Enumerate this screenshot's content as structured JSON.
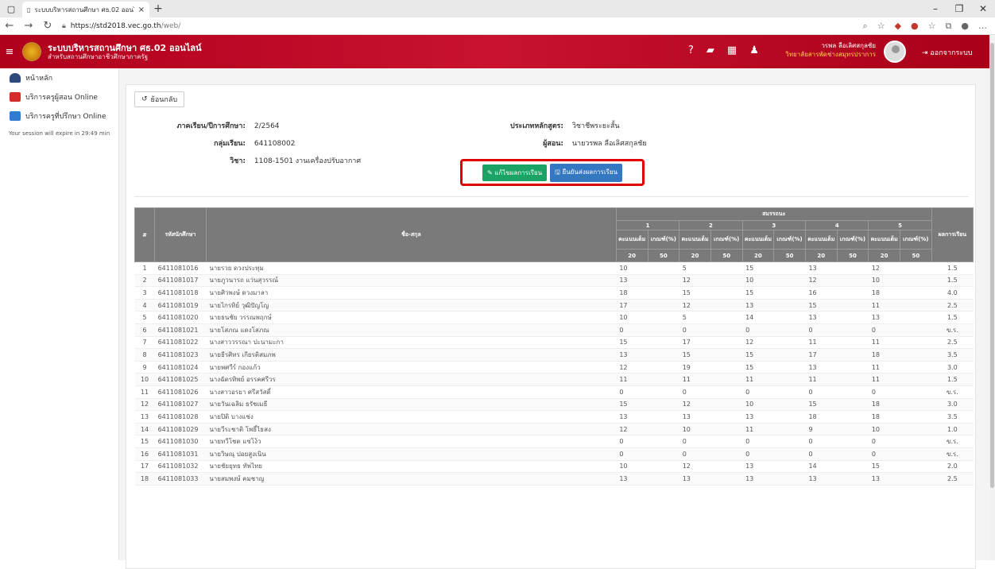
{
  "browser": {
    "tab_title": "ระบบบริหารสถานศึกษา ศธ.02 ออนไล",
    "url_host": "https://std2018.vec.go.th",
    "url_path": "/web/"
  },
  "header": {
    "title": "ระบบบริหารสถานศึกษา ศธ.02 ออนไลน์",
    "subtitle": "สำหรับสถานศึกษาอาชีวศึกษาภาครัฐ",
    "user_name": "วรพล ลือเลิศสกุลชัย",
    "user_org": "วิทยาลัยสารพัดช่างสมุทรปราการ",
    "logout": "ออกจากระบบ"
  },
  "sidebar": {
    "items": [
      {
        "label": "หน้าหลัก"
      },
      {
        "label": "บริการครูผู้สอน Online"
      },
      {
        "label": "บริการครูที่ปรึกษา Online"
      }
    ],
    "session": "Your session will expire in 29:49 min"
  },
  "page": {
    "back_label": "ย้อนกลับ",
    "term_label": "ภาคเรียน/ปีการศึกษา:",
    "term_value": "2/2564",
    "group_label": "กลุ่มเรียน:",
    "group_value": "641108002",
    "subject_label": "วิชา:",
    "subject_value": "1108-1501  งานเครื่องปรับอากาศ",
    "course_type_label": "ประเภทหลักสูตร:",
    "course_type_value": "วิชาชีพระยะสั้น",
    "teacher_label": "ผู้สอน:",
    "teacher_value": "นายวรพล ลือเลิศสกุลชัย",
    "edit_button": "แก้ไขผลการเรียน",
    "confirm_button": "ยืนยันส่งผลการเรียน"
  },
  "table": {
    "h_no": "#",
    "h_id": "รหัสนักศึกษา",
    "h_name": "ชื่อ-สกุล",
    "h_comp": "สมรรถนะ",
    "h_result": "ผลการเรียน",
    "comp_nums": [
      "1",
      "2",
      "3",
      "4",
      "5"
    ],
    "h_score": "คะแนนเต็ม",
    "h_crit": "เกณฑ์(%)",
    "h_score_val": "20",
    "h_crit_val": "50",
    "rows": [
      [
        "1",
        "6411081016",
        "นายรวย ดวงประทุม",
        "10",
        "5",
        "15",
        "13",
        "12",
        "1.5"
      ],
      [
        "2",
        "6411081017",
        "นายภูวนารถ แว่นสุวรรณ์",
        "13",
        "12",
        "10",
        "12",
        "10",
        "1.5"
      ],
      [
        "3",
        "6411081018",
        "นายศิวพงษ์ ดวงมาลา",
        "18",
        "15",
        "15",
        "16",
        "18",
        "4.0"
      ],
      [
        "4",
        "6411081019",
        "นายไกรทิย์ วุฒิปัญโญ",
        "17",
        "12",
        "13",
        "15",
        "11",
        "2.5"
      ],
      [
        "5",
        "6411081020",
        "นายธนชัย วรรณพฤกษ์",
        "10",
        "5",
        "14",
        "13",
        "13",
        "1.5"
      ],
      [
        "6",
        "6411081021",
        "นายโสภณ แดงโสภณ",
        "0",
        "0",
        "0",
        "0",
        "0",
        "ข.ร."
      ],
      [
        "7",
        "6411081022",
        "นางสาววรรณา ปะนามะกา",
        "15",
        "17",
        "12",
        "11",
        "11",
        "2.5"
      ],
      [
        "8",
        "6411081023",
        "นายธีรศิทร เกียรติสมภพ",
        "13",
        "15",
        "15",
        "17",
        "18",
        "3.5"
      ],
      [
        "9",
        "6411081024",
        "นายพศวีร์ กองแก้ว",
        "12",
        "19",
        "15",
        "13",
        "11",
        "3.0"
      ],
      [
        "10",
        "6411081025",
        "นางฉัตรทิพย์ อรรคศรีวร",
        "11",
        "11",
        "11",
        "11",
        "11",
        "1.5"
      ],
      [
        "11",
        "6411081026",
        "นางสาวอรยา ศรีสวัสดิ์",
        "0",
        "0",
        "0",
        "0",
        "0",
        "ข.ร."
      ],
      [
        "12",
        "6411081027",
        "นายวันเฉลิม ธรัชเมธี",
        "15",
        "12",
        "10",
        "15",
        "18",
        "3.0"
      ],
      [
        "13",
        "6411081028",
        "นายปิติ บางแช่ง",
        "13",
        "13",
        "13",
        "18",
        "18",
        "3.5"
      ],
      [
        "14",
        "6411081029",
        "นายวีระชาติ โพธิ์ไธสง",
        "12",
        "10",
        "11",
        "9",
        "10",
        "1.0"
      ],
      [
        "15",
        "6411081030",
        "นายทวีโชต แซ่โง้ว",
        "0",
        "0",
        "0",
        "0",
        "0",
        "ข.ร."
      ],
      [
        "16",
        "6411081031",
        "นายวิษณุ ปอยสูงเนิน",
        "0",
        "0",
        "0",
        "0",
        "0",
        "ข.ร."
      ],
      [
        "17",
        "6411081032",
        "นายชัยยุทธ ทัพไทย",
        "10",
        "12",
        "13",
        "14",
        "15",
        "2.0"
      ],
      [
        "18",
        "6411081033",
        "นายสมพงษ์ คมชาญ",
        "13",
        "13",
        "13",
        "13",
        "13",
        "2.5"
      ]
    ]
  },
  "colors": {
    "header_red": "#c81230",
    "highlight_red": "#e00000",
    "btn_green": "#1aa364",
    "btn_blue": "#3578c2",
    "table_head": "#7a7a7a"
  }
}
